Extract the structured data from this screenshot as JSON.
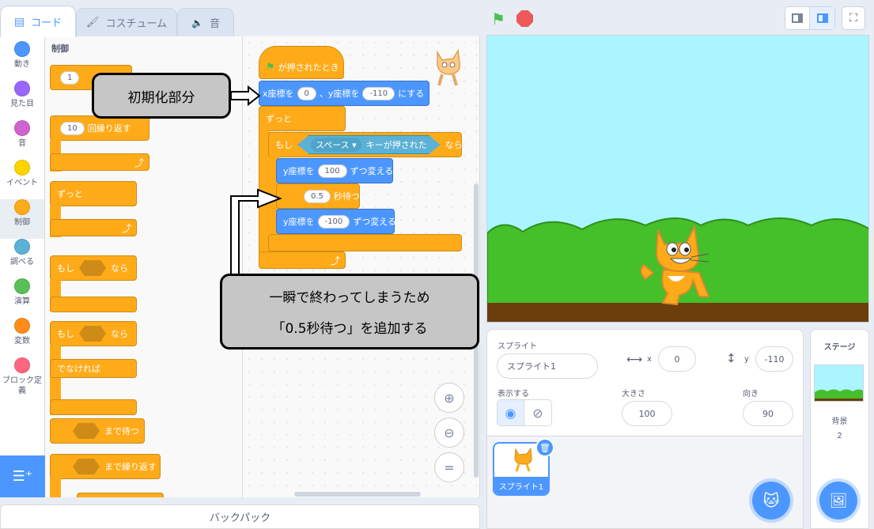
{
  "tabs": {
    "code": "コード",
    "costume": "コスチューム",
    "sound": "音"
  },
  "categories": [
    {
      "label": "動き",
      "color": "#4c97ff"
    },
    {
      "label": "見た目",
      "color": "#9966ff"
    },
    {
      "label": "音",
      "color": "#cf63cf"
    },
    {
      "label": "イベント",
      "color": "#ffd500"
    },
    {
      "label": "制御",
      "color": "#ffab19"
    },
    {
      "label": "調べる",
      "color": "#5cb1d6"
    },
    {
      "label": "演算",
      "color": "#59c059"
    },
    {
      "label": "変数",
      "color": "#ff8c1a"
    },
    {
      "label": "ブロック定義",
      "color": "#ff6680"
    }
  ],
  "palette": {
    "heading": "制御",
    "wait_value": "1",
    "repeat_value": "10",
    "repeat_label": "回繰り返す",
    "forever": "ずっと",
    "if": "もし",
    "then": "なら",
    "else": "でなければ",
    "wait_until": "まで待つ",
    "repeat_until": "まで繰り返す"
  },
  "script": {
    "hat": "が押されたとき",
    "goto_x_label": "x座標を",
    "goto_x": "0",
    "goto_y_label": "、y座標を",
    "goto_y": "-110",
    "goto_suffix": "にする",
    "forever": "ずっと",
    "if": "もし",
    "key": "スペース ▾",
    "key_pressed": "キーが押された",
    "then": "なら",
    "change_y_label": "y座標を",
    "change_up": "100",
    "change_suffix": "ずつ変える",
    "wait_value": "0.5",
    "wait_label": "秒待つ",
    "change_down": "-100"
  },
  "annotations": {
    "init": "初期化部分",
    "wait_note_1": "一瞬で終わってしまうため",
    "wait_note_2": "「0.5秒待つ」を追加する"
  },
  "backpack": "バックパック",
  "sprite_info": {
    "sprite_label": "スプライト",
    "sprite_name": "スプライト1",
    "x_label": "x",
    "x": "0",
    "y_label": "y",
    "y": "-110",
    "show_label": "表示する",
    "size_label": "大きさ",
    "size": "100",
    "direction_label": "向き",
    "direction": "90"
  },
  "sprite_thumb": "スプライト1",
  "stage_panel": {
    "title": "ステージ",
    "backdrop_label": "背景",
    "backdrop_count": "2"
  },
  "colors": {
    "accent": "#4c97ff",
    "control": "#ffab19",
    "motion": "#4c97ff",
    "sky": "#aaf5ff",
    "grass": "#45bf2a",
    "ground": "#6b3e0c"
  }
}
